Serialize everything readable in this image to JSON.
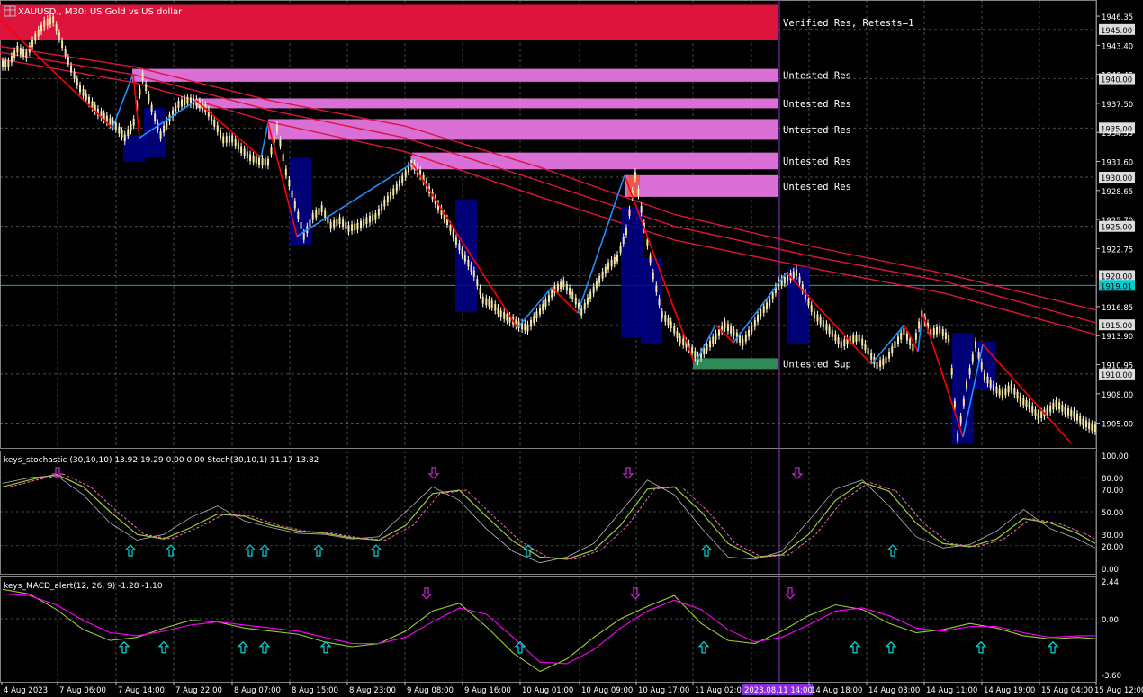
{
  "header": {
    "symbol": "XAUUSD., M30:  US Gold vs US dollar"
  },
  "colors": {
    "background": "#000000",
    "grid": "#c0c0c0",
    "verified_res_zone": "#dc143c",
    "untested_res_zone": "#da70d6",
    "untested_sup_zone": "#2e8b57",
    "zigzag_up": "#1e90ff",
    "zigzag_down": "#ff0000",
    "moving_averages": "#dc143c",
    "current_price_line": "#00ced1",
    "highlight_box": "#00008b",
    "vline": "#9932cc",
    "arrow_up": "#00ced1",
    "arrow_down": "#c71fd0"
  },
  "main_panel": {
    "price_axis_labels": [
      "1946.35",
      "1945.00",
      "1943.40",
      "1940.45",
      "1940.00",
      "1937.50",
      "1935.00",
      "1934.55",
      "1931.60",
      "1930.00",
      "1928.65",
      "1925.70",
      "1925.00",
      "1922.75",
      "1920.00",
      "1919.01",
      "1916.85",
      "1915.00",
      "1913.90",
      "1910.95",
      "1910.00",
      "1908.00",
      "1905.00"
    ],
    "current_price": "1919.01",
    "zones": [
      {
        "label": "Verified Res, Retests=1",
        "kind": "verified_res",
        "top": 1947.5,
        "bottom": 1943.9
      },
      {
        "label": "Untested Res",
        "kind": "untested_res",
        "top": 1941.0,
        "bottom": 1939.7
      },
      {
        "label": "Untested Res",
        "kind": "untested_res",
        "top": 1938.0,
        "bottom": 1937.0
      },
      {
        "label": "Untested Res",
        "kind": "untested_res",
        "top": 1935.9,
        "bottom": 1933.8
      },
      {
        "label": "Untested Res",
        "kind": "untested_res",
        "top": 1932.5,
        "bottom": 1930.8
      },
      {
        "label": "Untested Res",
        "kind": "untested_res",
        "top": 1930.2,
        "bottom": 1928.0
      },
      {
        "label": "Untested Sup",
        "kind": "untested_sup",
        "top": 1911.6,
        "bottom": 1910.5
      }
    ]
  },
  "stoch_panel": {
    "title": "keys_stochastic (30,10,10) 13.92 19.29 0.00 0.00 Stoch(30,10,1) 11.17 13.82",
    "levels": [
      "100.00",
      "80.00",
      "70.00",
      "50.00",
      "30.00",
      "20.00",
      "0.00"
    ]
  },
  "macd_panel": {
    "title": "keys_MACD_alert(12, 26, 9) -1.28 -1.10",
    "levels": [
      "2.44",
      "0.00",
      "-3.60"
    ]
  },
  "time_axis": {
    "labels": [
      "4 Aug 2023",
      "7 Aug 06:00",
      "7 Aug 14:00",
      "7 Aug 22:00",
      "8 Aug 07:00",
      "8 Aug 15:00",
      "8 Aug 23:00",
      "9 Aug 08:00",
      "9 Aug 16:00",
      "10 Aug 01:00",
      "10 Aug 09:00",
      "10 Aug 17:00",
      "11 Aug 02:00",
      "2023.08.11 14:00",
      "14 Aug 18:00",
      "14 Aug 03:00",
      "14 Aug 11:00",
      "14 Aug 19:00",
      "15 Aug 04:00",
      "15 Aug 12:00"
    ]
  },
  "chart_data": [
    {
      "type": "line",
      "title": "XAUUSD., M30:  US Gold vs US dollar",
      "ylim": [
        1902.5,
        1948.0
      ],
      "x": [
        0,
        10,
        20,
        30,
        40,
        50,
        60,
        70,
        80,
        90,
        100,
        110,
        120,
        130,
        140,
        150,
        160,
        170,
        180,
        190,
        200,
        210,
        220,
        230,
        240,
        250,
        260,
        270,
        280,
        290,
        300,
        310,
        320,
        330,
        340,
        350,
        360,
        370,
        380,
        390,
        400,
        410,
        420,
        430,
        440,
        450,
        460,
        470,
        480,
        490,
        500,
        510,
        520,
        530,
        540,
        550,
        560,
        570,
        580,
        590,
        600,
        610,
        620,
        630,
        640,
        650,
        660,
        670,
        680,
        690,
        700,
        710,
        720,
        730,
        740,
        750,
        760,
        770,
        780,
        790,
        800,
        810,
        820,
        830,
        840,
        850,
        860,
        870,
        880,
        890,
        900,
        910,
        920,
        930,
        940,
        950,
        960,
        970,
        980,
        990,
        1000,
        1010,
        1020,
        1030,
        1040,
        1050,
        1060,
        1070,
        1080,
        1090,
        1100,
        1110,
        1120,
        1130,
        1140,
        1150,
        1160,
        1170,
        1180,
        1190,
        1200,
        1210,
        1220
      ],
      "series": [
        {
          "values": [
            1941.5,
            1943.0,
            1942.4,
            1944.2,
            1945.6,
            1946.0,
            1943.5,
            1941.0,
            1939.0,
            1937.8,
            1936.6,
            1935.9,
            1935.2,
            1934.0,
            1935.6,
            1940.2,
            1937.0,
            1934.3,
            1936.0,
            1937.4,
            1937.8,
            1937.6,
            1937.0,
            1935.5,
            1933.8,
            1933.9,
            1932.8,
            1932.0,
            1931.6,
            1931.5,
            1935.0,
            1930.5,
            1927.2,
            1924.0,
            1926.0,
            1926.8,
            1925.1,
            1925.6,
            1924.8,
            1925.0,
            1925.6,
            1926.0,
            1927.4,
            1928.5,
            1929.8,
            1931.4,
            1930.4,
            1928.7,
            1927.0,
            1925.5,
            1923.5,
            1921.8,
            1920.2,
            1917.5,
            1917.1,
            1916.1,
            1915.6,
            1915.0,
            1914.7,
            1916.0,
            1917.2,
            1918.6,
            1919.2,
            1918.0,
            1916.3,
            1918.0,
            1919.6,
            1921.0,
            1921.8,
            1924.5,
            1930.2,
            1925.0,
            1920.0,
            1916.0,
            1915.0,
            1913.5,
            1912.8,
            1911.6,
            1912.7,
            1913.8,
            1915.0,
            1914.2,
            1913.2,
            1914.6,
            1916.2,
            1917.3,
            1919.2,
            1919.7,
            1920.3,
            1918.0,
            1916.0,
            1915.1,
            1914.1,
            1913.0,
            1913.5,
            1913.7,
            1912.3,
            1910.9,
            1911.4,
            1913.0,
            1914.3,
            1912.7,
            1916.1,
            1914.2,
            1914.5,
            1913.6,
            1903.6,
            1908.9,
            1913.0,
            1909.8,
            1908.6,
            1908.0,
            1908.7,
            1907.4,
            1906.8,
            1905.7,
            1906.2,
            1907.0,
            1906.3,
            1905.9,
            1905.1,
            1904.6,
            1904.3
          ]
        }
      ]
    },
    {
      "type": "line",
      "title": "keys_stochastic (30,10,10) 13.92 19.29 0.00 0.00 Stoch(30,10,1) 11.17 13.82",
      "ylim": [
        0,
        100
      ],
      "x": [
        0,
        30,
        60,
        90,
        120,
        150,
        180,
        210,
        240,
        270,
        300,
        330,
        360,
        390,
        420,
        450,
        480,
        510,
        540,
        570,
        600,
        630,
        660,
        690,
        720,
        750,
        780,
        810,
        840,
        870,
        900,
        930,
        960,
        990,
        1020,
        1050,
        1080,
        1110,
        1140,
        1170,
        1200,
        1220
      ],
      "series": [
        {
          "values": [
            75,
            80,
            82,
            65,
            40,
            25,
            30,
            45,
            55,
            42,
            36,
            31,
            30,
            26,
            28,
            50,
            72,
            60,
            35,
            15,
            5,
            10,
            22,
            50,
            78,
            65,
            36,
            10,
            8,
            15,
            42,
            70,
            78,
            55,
            28,
            18,
            21,
            33,
            52,
            35,
            26,
            18
          ]
        },
        {
          "values": [
            72,
            78,
            83,
            72,
            50,
            30,
            26,
            36,
            48,
            46,
            38,
            33,
            31,
            27,
            25,
            38,
            66,
            69,
            46,
            24,
            10,
            8,
            16,
            38,
            70,
            72,
            50,
            22,
            10,
            12,
            30,
            60,
            76,
            68,
            40,
            22,
            19,
            26,
            44,
            40,
            31,
            22
          ]
        }
      ]
    },
    {
      "type": "line",
      "title": "keys_MACD_alert(12, 26, 9) -1.28 -1.10",
      "ylim": [
        -3.6,
        2.44
      ],
      "x": [
        0,
        30,
        60,
        90,
        120,
        150,
        180,
        210,
        240,
        270,
        300,
        330,
        360,
        390,
        420,
        450,
        480,
        510,
        540,
        570,
        600,
        630,
        660,
        690,
        720,
        750,
        780,
        810,
        840,
        870,
        900,
        930,
        960,
        990,
        1020,
        1050,
        1080,
        1110,
        1140,
        1170,
        1200,
        1220
      ],
      "series": [
        {
          "values": [
            1.9,
            1.6,
            0.6,
            -0.7,
            -1.4,
            -1.2,
            -0.6,
            -0.1,
            -0.2,
            -0.6,
            -0.8,
            -1.0,
            -1.5,
            -1.8,
            -1.6,
            -0.8,
            0.5,
            1.0,
            -0.5,
            -2.2,
            -3.4,
            -2.6,
            -1.2,
            0.0,
            0.8,
            1.5,
            -0.3,
            -1.4,
            -1.6,
            -0.8,
            0.2,
            0.9,
            0.6,
            -0.3,
            -0.9,
            -0.7,
            -0.3,
            -0.6,
            -1.1,
            -1.3,
            -1.2,
            -1.28
          ]
        },
        {
          "values": [
            1.6,
            1.5,
            0.9,
            -0.1,
            -0.9,
            -1.1,
            -0.8,
            -0.4,
            -0.2,
            -0.4,
            -0.6,
            -0.8,
            -1.2,
            -1.6,
            -1.6,
            -1.2,
            -0.2,
            0.7,
            0.3,
            -1.2,
            -2.8,
            -2.9,
            -2.0,
            -0.6,
            0.5,
            1.2,
            0.6,
            -0.7,
            -1.5,
            -1.2,
            -0.4,
            0.5,
            0.7,
            0.2,
            -0.6,
            -0.8,
            -0.5,
            -0.5,
            -0.9,
            -1.2,
            -1.1,
            -1.1
          ]
        }
      ]
    }
  ]
}
